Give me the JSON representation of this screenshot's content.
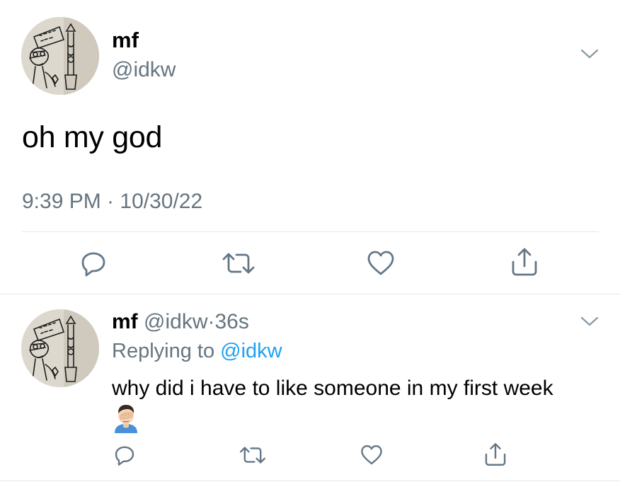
{
  "main_tweet": {
    "author_name": "mf",
    "author_handle": "@idkw",
    "text": "oh my god",
    "timestamp": "9:39 PM · 10/30/22",
    "avatar_icon": "avatar-drawing-icon",
    "menu_icon": "chevron-down-icon",
    "actions": {
      "reply_icon": "reply-icon",
      "retweet_icon": "retweet-icon",
      "like_icon": "heart-icon",
      "share_icon": "share-icon"
    }
  },
  "reply_tweet": {
    "author_name": "mf",
    "author_handle": "@idkw",
    "separator": "·",
    "age": "36s",
    "replying_to_prefix": "Replying to ",
    "replying_to_handle": "@idkw",
    "text": "why did i have to like someone in my first week",
    "emoji": "🤦🏻‍♂️",
    "avatar_icon": "avatar-drawing-icon",
    "menu_icon": "chevron-down-icon",
    "actions": {
      "reply_icon": "reply-icon",
      "retweet_icon": "retweet-icon",
      "like_icon": "heart-icon",
      "share_icon": "share-icon"
    }
  },
  "colors": {
    "primary_text": "#000000",
    "secondary_text": "#66757f",
    "link": "#1da1f2",
    "icon": "#657786",
    "divider": "#e1e8ed"
  }
}
